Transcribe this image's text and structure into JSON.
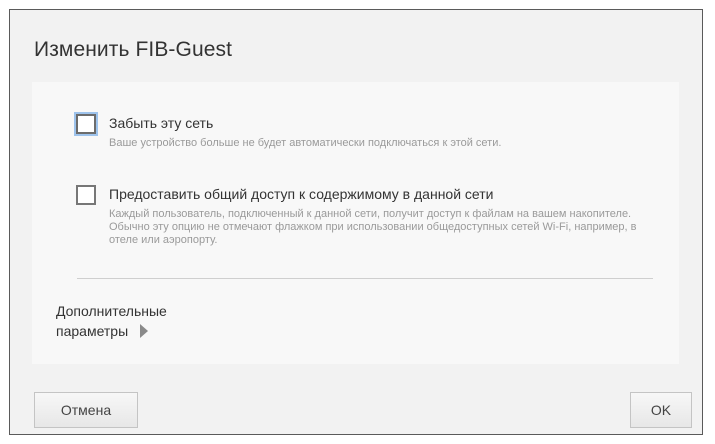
{
  "dialog": {
    "title": "Изменить FIB-Guest"
  },
  "options": [
    {
      "label": "Забыть эту сеть",
      "description": "Ваше устройство больше не будет автоматически подключаться к этой сети.",
      "checked": false
    },
    {
      "label": "Предоставить общий доступ к содержимому в данной сети",
      "description": "Каждый пользователь, подключенный к данной сети, получит доступ к файлам на вашем накопителе. Обычно эту опцию не отмечают флажком при использовании общедоступных сетей Wi-Fi, например, в отеле или аэропорту.",
      "checked": false
    }
  ],
  "advanced": {
    "line1": "Дополнительные",
    "line2": "параметры"
  },
  "buttons": {
    "cancel": "Отмена",
    "ok": "OK"
  }
}
